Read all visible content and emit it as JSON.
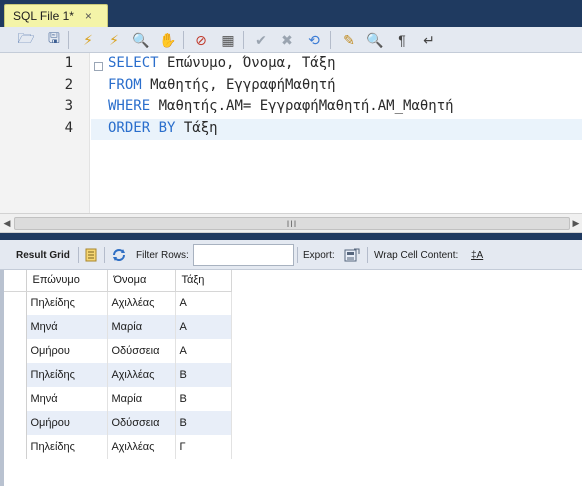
{
  "tab": {
    "label": "SQL File 1*",
    "close": "×"
  },
  "toolbar": {
    "buttons": [
      {
        "name": "open-folder-icon",
        "glyph": "🗁",
        "color": "#4a6fa8"
      },
      {
        "name": "save-icon",
        "glyph": "🖫",
        "color": "#3d5f93"
      },
      {
        "name": "execute-icon",
        "glyph": "⚡",
        "color": "#d9a21e"
      },
      {
        "name": "execute-current-icon",
        "glyph": "⚡",
        "color": "#d9a21e"
      },
      {
        "name": "explain-icon",
        "glyph": "🔍",
        "color": "#6b6b6b"
      },
      {
        "name": "stop-icon",
        "glyph": "✋",
        "color": "#7c7c7c"
      },
      {
        "name": "toggle-error-icon",
        "glyph": "⊘",
        "color": "#c0392b"
      },
      {
        "name": "results-toggle-icon",
        "glyph": "▦",
        "color": "#555555"
      },
      {
        "name": "commit-icon",
        "glyph": "✔",
        "color": "#9aa4b0"
      },
      {
        "name": "rollback-icon",
        "glyph": "✖",
        "color": "#9aa4b0"
      },
      {
        "name": "autocommit-icon",
        "glyph": "⟲",
        "color": "#3a7bd5"
      },
      {
        "name": "beautify-icon",
        "glyph": "✎",
        "color": "#c08a1e"
      },
      {
        "name": "find-icon",
        "glyph": "🔍",
        "color": "#555555"
      },
      {
        "name": "invisible-chars-icon",
        "glyph": "¶",
        "color": "#444444"
      },
      {
        "name": "wrap-lines-icon",
        "glyph": "↵",
        "color": "#444444"
      }
    ]
  },
  "editor": {
    "line_numbers": [
      "1",
      "2",
      "3",
      "4"
    ],
    "lines": [
      [
        {
          "t": "SELECT",
          "kw": true
        },
        {
          "t": " Επώνυμο, Όνομα, Τάξη",
          "kw": false
        }
      ],
      [
        {
          "t": "FROM",
          "kw": true
        },
        {
          "t": " Μαθητής, ΕγγραφήΜαθητή",
          "kw": false
        }
      ],
      [
        {
          "t": "WHERE",
          "kw": true
        },
        {
          "t": " Μαθητής.ΑΜ= ΕγγραφήΜαθητή.ΑΜ_Μαθητή",
          "kw": false
        }
      ],
      [
        {
          "t": "ORDER BY",
          "kw": true
        },
        {
          "t": " Τάξη",
          "kw": false
        }
      ]
    ]
  },
  "scrollbar": {
    "left_arrow": "◀",
    "right_arrow": "▶",
    "thumb_grip": "III"
  },
  "result_toolbar": {
    "result_grid_label": "Result Grid",
    "filter_rows_label": "Filter Rows:",
    "filter_value": "",
    "export_label": "Export:",
    "wrap_label": "Wrap Cell Content:",
    "wrap_icon": "‡A"
  },
  "grid": {
    "columns": [
      "Επώνυμο",
      "Όνομα",
      "Τάξη"
    ],
    "rows": [
      [
        "Πηλείδης",
        "Αχιλλέας",
        "Α"
      ],
      [
        "Μηνά",
        "Μαρία",
        "Α"
      ],
      [
        "Ομήρου",
        "Οδύσσεια",
        "Α"
      ],
      [
        "Πηλείδης",
        "Αχιλλέας",
        "Β"
      ],
      [
        "Μηνά",
        "Μαρία",
        "Β"
      ],
      [
        "Ομήρου",
        "Οδύσσεια",
        "Β"
      ],
      [
        "Πηλείδης",
        "Αχιλλέας",
        "Γ"
      ]
    ]
  }
}
